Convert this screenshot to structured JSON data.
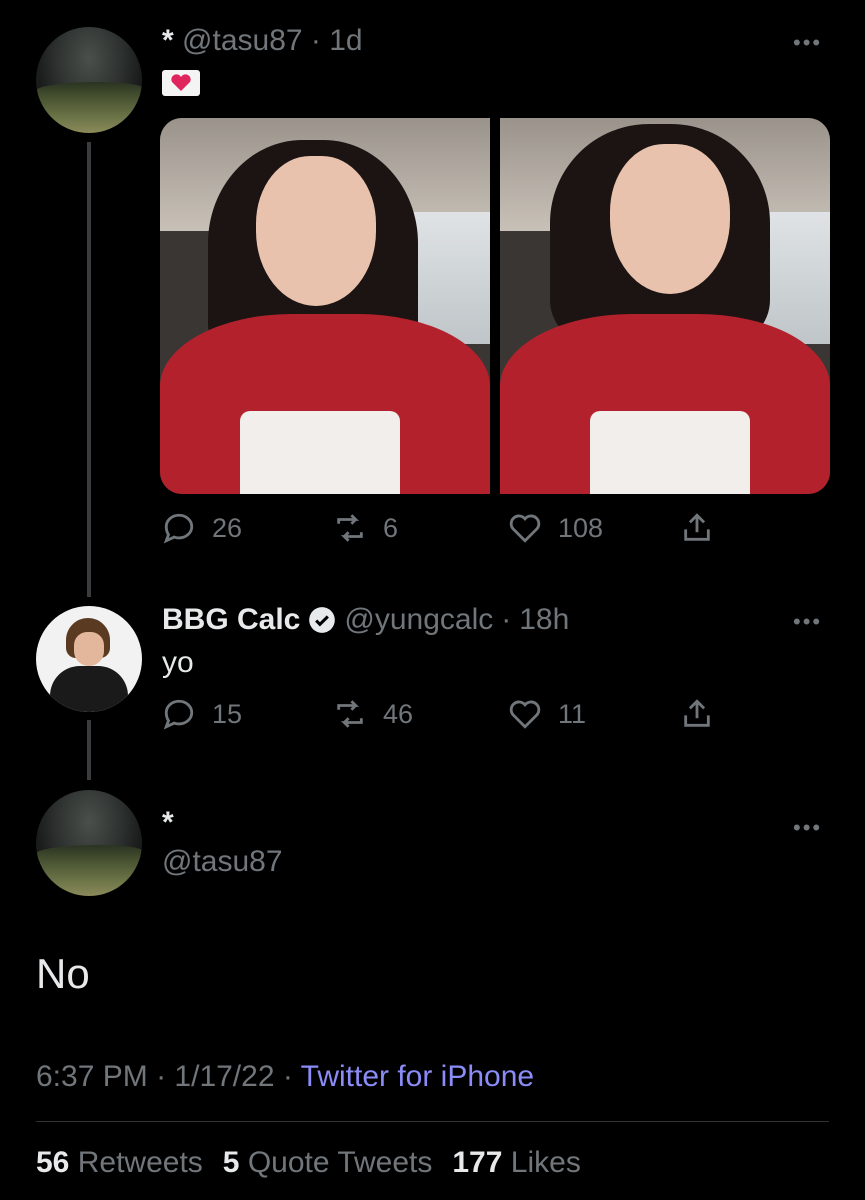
{
  "tweet1": {
    "display_name": "*",
    "handle": "@tasu87",
    "time": "1d",
    "emoji": "💌",
    "actions": {
      "replies": "26",
      "retweets": "6",
      "likes": "108"
    }
  },
  "tweet2": {
    "display_name": "BBG Calc",
    "handle": "@yungcalc",
    "time": "18h",
    "text": "yo",
    "actions": {
      "replies": "15",
      "retweets": "46",
      "likes": "11"
    }
  },
  "main": {
    "display_name": "*",
    "handle": "@tasu87",
    "text": "No",
    "time": "6:37 PM",
    "date": "1/17/22",
    "source": "Twitter for iPhone"
  },
  "stats": {
    "retweets_count": "56",
    "retweets_label": "Retweets",
    "quotes_count": "5",
    "quotes_label": "Quote Tweets",
    "likes_count": "177",
    "likes_label": "Likes"
  },
  "colors": {
    "background": "#000000",
    "text": "#e7e9ea",
    "muted": "#71767b",
    "link": "#8b8cf7",
    "verified": "#e7e9ea"
  },
  "icons": [
    "more-icon",
    "reply-icon",
    "retweet-icon",
    "like-icon",
    "share-icon",
    "verified-badge-icon"
  ]
}
